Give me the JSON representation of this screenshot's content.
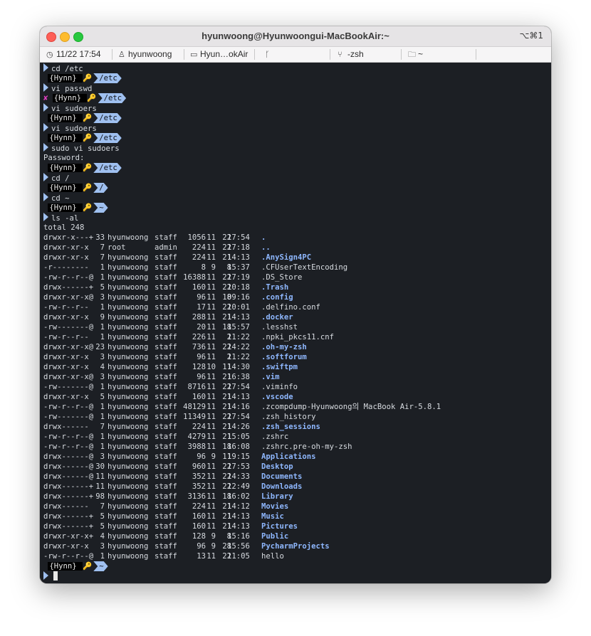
{
  "window": {
    "title": "hyunwoong@Hyunwoongui-MacBookAir:~",
    "shortcut": "⌥⌘1"
  },
  "statusbar": {
    "datetime": "11/22 17:54",
    "user": "hyunwoong",
    "host": "Hyun…okAir",
    "branch": "",
    "job": "-zsh",
    "cwd": "~"
  },
  "prompt": {
    "user": "{Hynn}",
    "key": "🔑",
    "error": "✘"
  },
  "history": [
    {
      "type": "cmd",
      "text": "cd /etc"
    },
    {
      "type": "prompt",
      "dir": "/etc",
      "error": false
    },
    {
      "type": "cmd",
      "text": "vi passwd"
    },
    {
      "type": "prompt",
      "dir": "/etc",
      "error": true
    },
    {
      "type": "cmd",
      "text": "vi sudoers"
    },
    {
      "type": "prompt",
      "dir": "/etc",
      "error": false
    },
    {
      "type": "cmd",
      "text": "vi sudoers"
    },
    {
      "type": "prompt",
      "dir": "/etc",
      "error": false
    },
    {
      "type": "cmd",
      "text": "sudo vi sudoers"
    },
    {
      "type": "out",
      "text": "Password:"
    },
    {
      "type": "prompt",
      "dir": "/etc",
      "error": false
    },
    {
      "type": "cmd",
      "text": "cd /"
    },
    {
      "type": "prompt",
      "dir": "/",
      "error": false
    },
    {
      "type": "cmd",
      "text": "cd ~"
    },
    {
      "type": "prompt",
      "dir": "~",
      "error": false
    },
    {
      "type": "cmd",
      "text": "ls -al"
    },
    {
      "type": "out",
      "text": "total 248"
    }
  ],
  "listing": [
    {
      "perm": "drwxr-x---+",
      "links": "33",
      "owner": "hyunwoong",
      "group": "staff",
      "size": "1056",
      "mon": "11",
      "day": "22",
      "time": "17:54",
      "name": ".",
      "dir": true
    },
    {
      "perm": "drwxr-xr-x",
      "links": "7",
      "owner": "root",
      "group": "admin",
      "size": "224",
      "mon": "11",
      "day": "22",
      "time": "17:18",
      "name": "..",
      "dir": true
    },
    {
      "perm": "drwxr-xr-x",
      "links": "7",
      "owner": "hyunwoong",
      "group": "staff",
      "size": "224",
      "mon": "11",
      "day": "21",
      "time": "14:13",
      "name": ".AnySign4PC",
      "dir": true
    },
    {
      "perm": "-r--------",
      "links": "1",
      "owner": "hyunwoong",
      "group": "staff",
      "size": "8",
      "mon": "9",
      "day": "8",
      "time": "15:37",
      "name": ".CFUserTextEncoding",
      "dir": false
    },
    {
      "perm": "-rw-r--r--@",
      "links": "1",
      "owner": "hyunwoong",
      "group": "staff",
      "size": "16388",
      "mon": "11",
      "day": "22",
      "time": "17:19",
      "name": ".DS_Store",
      "dir": false
    },
    {
      "perm": "drwx------+",
      "links": "5",
      "owner": "hyunwoong",
      "group": "staff",
      "size": "160",
      "mon": "11",
      "day": "22",
      "time": "10:18",
      "name": ".Trash",
      "dir": true
    },
    {
      "perm": "drwxr-xr-x@",
      "links": "3",
      "owner": "hyunwoong",
      "group": "staff",
      "size": "96",
      "mon": "11",
      "day": "18",
      "time": "09:16",
      "name": ".config",
      "dir": true
    },
    {
      "perm": "-rw-r--r--",
      "links": "1",
      "owner": "hyunwoong",
      "group": "staff",
      "size": "17",
      "mon": "11",
      "day": "22",
      "time": "10:01",
      "name": ".delfino.conf",
      "dir": false
    },
    {
      "perm": "drwxr-xr-x",
      "links": "9",
      "owner": "hyunwoong",
      "group": "staff",
      "size": "288",
      "mon": "11",
      "day": "21",
      "time": "14:13",
      "name": ".docker",
      "dir": true
    },
    {
      "perm": "-rw-------@",
      "links": "1",
      "owner": "hyunwoong",
      "group": "staff",
      "size": "20",
      "mon": "11",
      "day": "18",
      "time": "15:57",
      "name": ".lesshst",
      "dir": false
    },
    {
      "perm": "-rw-r--r--",
      "links": "1",
      "owner": "hyunwoong",
      "group": "staff",
      "size": "226",
      "mon": "11",
      "day": "2",
      "time": "11:22",
      "name": ".npki_pkcs11.cnf",
      "dir": false
    },
    {
      "perm": "drwxr-xr-x@",
      "links": "23",
      "owner": "hyunwoong",
      "group": "staff",
      "size": "736",
      "mon": "11",
      "day": "22",
      "time": "14:22",
      "name": ".oh-my-zsh",
      "dir": true
    },
    {
      "perm": "drwxr-xr-x",
      "links": "3",
      "owner": "hyunwoong",
      "group": "staff",
      "size": "96",
      "mon": "11",
      "day": "2",
      "time": "11:22",
      "name": ".softforum",
      "dir": true
    },
    {
      "perm": "drwxr-xr-x",
      "links": "4",
      "owner": "hyunwoong",
      "group": "staff",
      "size": "128",
      "mon": "10",
      "day": "11",
      "time": "14:30",
      "name": ".swiftpm",
      "dir": true
    },
    {
      "perm": "drwxr-xr-x@",
      "links": "3",
      "owner": "hyunwoong",
      "group": "staff",
      "size": "96",
      "mon": "11",
      "day": "21",
      "time": "16:38",
      "name": ".vim",
      "dir": true
    },
    {
      "perm": "-rw-------@",
      "links": "1",
      "owner": "hyunwoong",
      "group": "staff",
      "size": "8716",
      "mon": "11",
      "day": "22",
      "time": "17:54",
      "name": ".viminfo",
      "dir": false
    },
    {
      "perm": "drwxr-xr-x",
      "links": "5",
      "owner": "hyunwoong",
      "group": "staff",
      "size": "160",
      "mon": "11",
      "day": "21",
      "time": "14:13",
      "name": ".vscode",
      "dir": true
    },
    {
      "perm": "-rw-r--r--@",
      "links": "1",
      "owner": "hyunwoong",
      "group": "staff",
      "size": "48129",
      "mon": "11",
      "day": "21",
      "time": "14:16",
      "name": ".zcompdump-Hyunwoong의 MacBook Air-5.8.1",
      "dir": false
    },
    {
      "perm": "-rw-------@",
      "links": "1",
      "owner": "hyunwoong",
      "group": "staff",
      "size": "11349",
      "mon": "11",
      "day": "22",
      "time": "17:54",
      "name": ".zsh_history",
      "dir": false
    },
    {
      "perm": "drwx------",
      "links": "7",
      "owner": "hyunwoong",
      "group": "staff",
      "size": "224",
      "mon": "11",
      "day": "21",
      "time": "14:26",
      "name": ".zsh_sessions",
      "dir": true
    },
    {
      "perm": "-rw-r--r--@",
      "links": "1",
      "owner": "hyunwoong",
      "group": "staff",
      "size": "4279",
      "mon": "11",
      "day": "21",
      "time": "15:05",
      "name": ".zshrc",
      "dir": false
    },
    {
      "perm": "-rw-r--r--@",
      "links": "1",
      "owner": "hyunwoong",
      "group": "staff",
      "size": "3988",
      "mon": "11",
      "day": "18",
      "time": "16:08",
      "name": ".zshrc.pre-oh-my-zsh",
      "dir": false
    },
    {
      "perm": "drwx------@",
      "links": "3",
      "owner": "hyunwoong",
      "group": "staff",
      "size": "96",
      "mon": "9",
      "day": "11",
      "time": "19:15",
      "name": "Applications",
      "dir": true
    },
    {
      "perm": "drwx------@",
      "links": "30",
      "owner": "hyunwoong",
      "group": "staff",
      "size": "960",
      "mon": "11",
      "day": "22",
      "time": "17:53",
      "name": "Desktop",
      "dir": true
    },
    {
      "perm": "drwx------@",
      "links": "11",
      "owner": "hyunwoong",
      "group": "staff",
      "size": "352",
      "mon": "11",
      "day": "22",
      "time": "14:33",
      "name": "Documents",
      "dir": true
    },
    {
      "perm": "drwx------+",
      "links": "11",
      "owner": "hyunwoong",
      "group": "staff",
      "size": "352",
      "mon": "11",
      "day": "22",
      "time": "12:49",
      "name": "Downloads",
      "dir": true
    },
    {
      "perm": "drwx------+",
      "links": "98",
      "owner": "hyunwoong",
      "group": "staff",
      "size": "3136",
      "mon": "11",
      "day": "18",
      "time": "16:02",
      "name": "Library",
      "dir": true
    },
    {
      "perm": "drwx------",
      "links": "7",
      "owner": "hyunwoong",
      "group": "staff",
      "size": "224",
      "mon": "11",
      "day": "21",
      "time": "14:12",
      "name": "Movies",
      "dir": true
    },
    {
      "perm": "drwx------+",
      "links": "5",
      "owner": "hyunwoong",
      "group": "staff",
      "size": "160",
      "mon": "11",
      "day": "21",
      "time": "14:13",
      "name": "Music",
      "dir": true
    },
    {
      "perm": "drwx------+",
      "links": "5",
      "owner": "hyunwoong",
      "group": "staff",
      "size": "160",
      "mon": "11",
      "day": "21",
      "time": "14:13",
      "name": "Pictures",
      "dir": true
    },
    {
      "perm": "drwxr-xr-x+",
      "links": "4",
      "owner": "hyunwoong",
      "group": "staff",
      "size": "128",
      "mon": "9",
      "day": "8",
      "time": "15:16",
      "name": "Public",
      "dir": true
    },
    {
      "perm": "drwxr-xr-x",
      "links": "3",
      "owner": "hyunwoong",
      "group": "staff",
      "size": "96",
      "mon": "9",
      "day": "28",
      "time": "15:56",
      "name": "PycharmProjects",
      "dir": true
    },
    {
      "perm": "-rw-r--r--@",
      "links": "1",
      "owner": "hyunwoong",
      "group": "staff",
      "size": "13",
      "mon": "11",
      "day": "22",
      "time": "11:05",
      "name": "hello",
      "dir": false
    }
  ],
  "final_prompt": {
    "dir": "~"
  },
  "colors": {
    "prompt_arrow": "#9fc0f0",
    "dir_text": "#8fb8ff",
    "background": "#1c1f24",
    "error": "#e040c0"
  }
}
